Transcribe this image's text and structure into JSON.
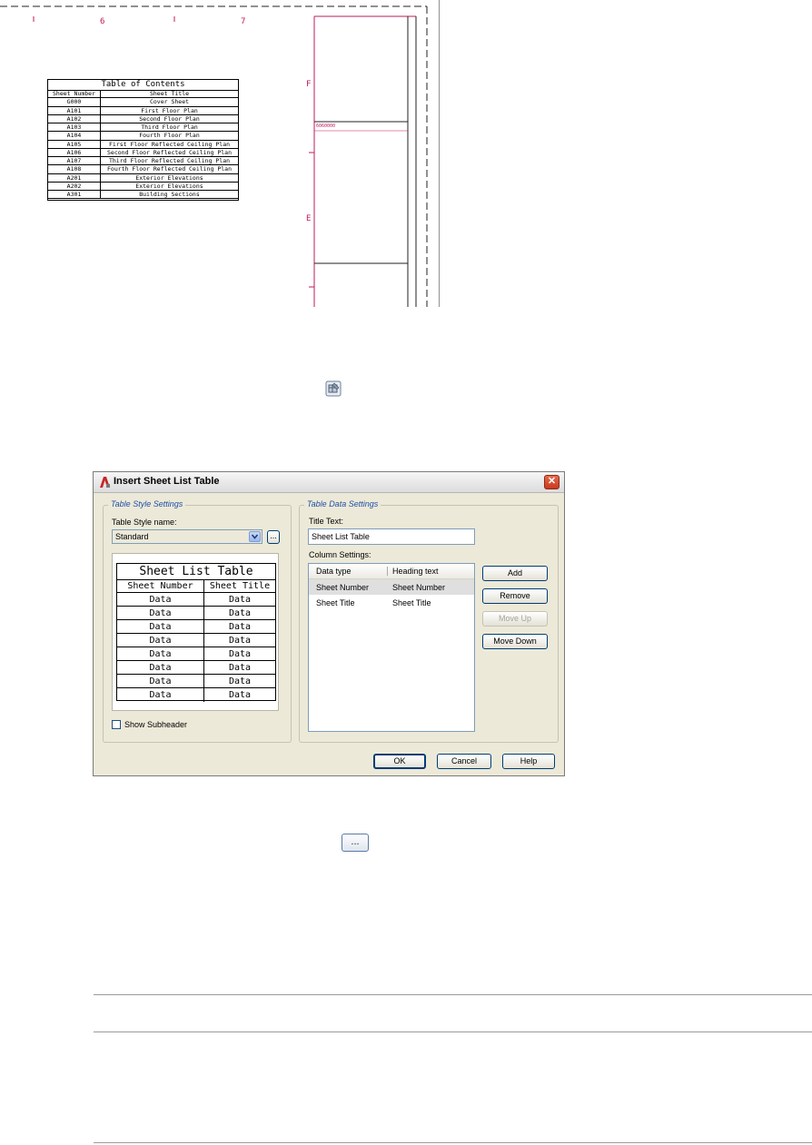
{
  "drawing": {
    "column_labels": [
      "6",
      "7"
    ],
    "row_labels": [
      "F",
      "E"
    ],
    "small_label": "6060000",
    "toc": {
      "title": "Table of Contents",
      "headers": [
        "Sheet Number",
        "Sheet Title"
      ],
      "rows": [
        [
          "G000",
          "Cover Sheet"
        ],
        [
          "A101",
          "First Floor Plan"
        ],
        [
          "A102",
          "Second Floor Plan"
        ],
        [
          "A103",
          "Third Floor Plan"
        ],
        [
          "A104",
          "Fourth Floor Plan"
        ],
        [
          "A105",
          "First Floor Reflected Ceiling Plan"
        ],
        [
          "A106",
          "Second Floor Reflected Ceiling Plan"
        ],
        [
          "A107",
          "Third Floor Reflected Ceiling Plan"
        ],
        [
          "A108",
          "Fourth Floor Reflected Ceiling Plan"
        ],
        [
          "A201",
          "Exterior Elevations"
        ],
        [
          "A202",
          "Exterior Elevations"
        ],
        [
          "A301",
          "Building Sections"
        ]
      ]
    }
  },
  "icons": {
    "tool_icon": "sheet-list-table-tool-icon",
    "ellipsis_button_label": "..."
  },
  "dialog": {
    "title": "Insert Sheet List Table",
    "close_glyph": "✕",
    "style_group": {
      "legend": "Table Style Settings",
      "style_name_label": "Table Style name:",
      "style_name_value": "Standard",
      "browse_label": "...",
      "preview": {
        "title": "Sheet List Table",
        "headers": [
          "Sheet Number",
          "Sheet Title"
        ],
        "rows": [
          [
            "Data",
            "Data"
          ],
          [
            "Data",
            "Data"
          ],
          [
            "Data",
            "Data"
          ],
          [
            "Data",
            "Data"
          ],
          [
            "Data",
            "Data"
          ],
          [
            "Data",
            "Data"
          ],
          [
            "Data",
            "Data"
          ],
          [
            "Data",
            "Data"
          ]
        ]
      },
      "show_subheader_label": "Show Subheader",
      "show_subheader_checked": false
    },
    "data_group": {
      "legend": "Table Data Settings",
      "title_text_label": "Title Text:",
      "title_text_value": "Sheet List Table",
      "column_settings_label": "Column Settings:",
      "columns_header": [
        "Data type",
        "Heading text"
      ],
      "columns": [
        [
          "Sheet Number",
          "Sheet Number"
        ],
        [
          "Sheet Title",
          "Sheet Title"
        ]
      ],
      "buttons": {
        "add": "Add",
        "remove": "Remove",
        "move_up": "Move Up",
        "move_down": "Move Down"
      }
    },
    "footer": {
      "ok": "OK",
      "cancel": "Cancel",
      "help": "Help"
    }
  },
  "colors": {
    "cad_magenta": "#c2185b",
    "dialog_bg": "#ece9d8",
    "group_title_blue": "#1f4fa8"
  }
}
